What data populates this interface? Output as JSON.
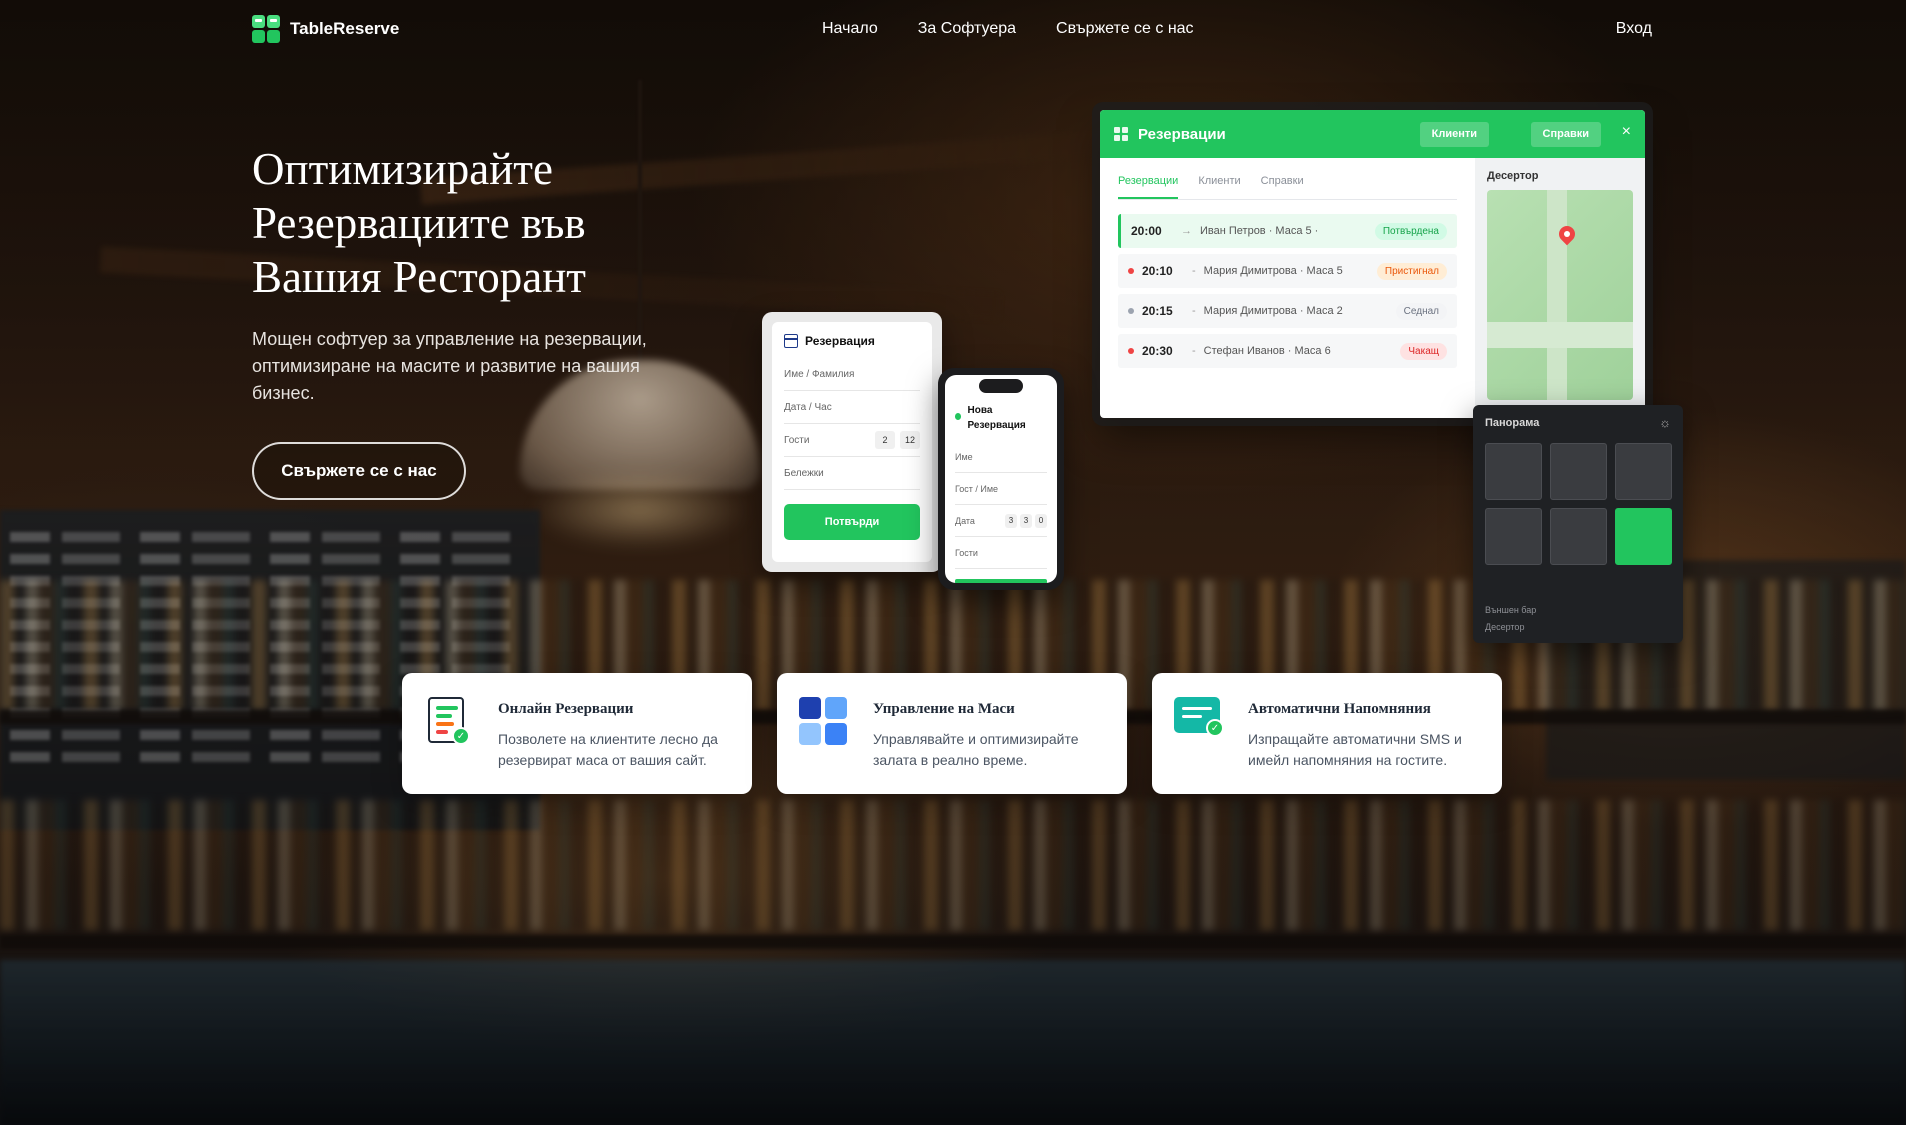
{
  "nav": {
    "brand": "TableReserve",
    "links": [
      "Начало",
      "За Софтуера",
      "Свържете се с нас"
    ],
    "login": "Вход"
  },
  "hero": {
    "title_lines": [
      "Оптимизирайте",
      "Резервациите във",
      "Вашия Ресторант"
    ],
    "subtitle": "Мощен софтуер за управление на резервации, оптимизиране на масите и развитие на вашия бизнес.",
    "cta": "Свържете се с нас"
  },
  "app": {
    "title": "Резервации",
    "btn_clients": "Клиенти",
    "btn_reports": "Справки",
    "close": "×",
    "tabs": [
      "Резервации",
      "Клиенти",
      "Справки"
    ],
    "reservations": [
      {
        "time": "20:00",
        "name": "Иван Петров · Маса 5 ·",
        "status": "Потвърдена",
        "status_color": "#16a34a",
        "status_bg": "#d1fae5",
        "dot": "#22c55e",
        "marker": "→"
      },
      {
        "time": "20:10",
        "name": "Мария Димитрова · Маса 5",
        "status": "Пристигнал",
        "status_color": "#ea580c",
        "status_bg": "#ffedd5",
        "dot": "#ef4444",
        "marker": "-"
      },
      {
        "time": "20:15",
        "name": "Мария Димитрова · Маса 2",
        "status": "Седнал",
        "status_color": "#6b7280",
        "status_bg": "#f3f4f6",
        "dot": "#9ca3af",
        "marker": "-"
      },
      {
        "time": "20:30",
        "name": "Стефан Иванов · Маса 6",
        "status": "Чакащ",
        "status_color": "#dc2626",
        "status_bg": "#fee2e2",
        "dot": "#ef4444",
        "marker": "-"
      }
    ],
    "side_title": "Десертор"
  },
  "panel": {
    "title": "Панорама",
    "footer": [
      "Външен бар",
      "Десертор"
    ]
  },
  "tablet": {
    "title": "Резервация",
    "fields": [
      "Име / Фамилия",
      "Дата / Час",
      "Гости",
      "Бележки"
    ],
    "guests_chips": [
      "2",
      "12"
    ],
    "button": "Потвърди"
  },
  "phone": {
    "title": "Нова Резервация",
    "fields": [
      "Име",
      "Гост / Име",
      "Дата",
      "Гости"
    ],
    "date_chips": [
      "3",
      "3",
      "0"
    ]
  },
  "features": [
    {
      "title": "Онлайн Резервации",
      "text": "Позволете на клиентите лесно да резервират маса от вашия сайт."
    },
    {
      "title": "Управление на Маси",
      "text": "Управлявайте и оптимизирайте залата в реално време."
    },
    {
      "title": "Автоматични Напомняния",
      "text": "Изпращайте автоматични SMS и имейл напомняния на гостите."
    }
  ],
  "colors": {
    "accent": "#22c55e",
    "accent_dark": "#16a34a"
  }
}
